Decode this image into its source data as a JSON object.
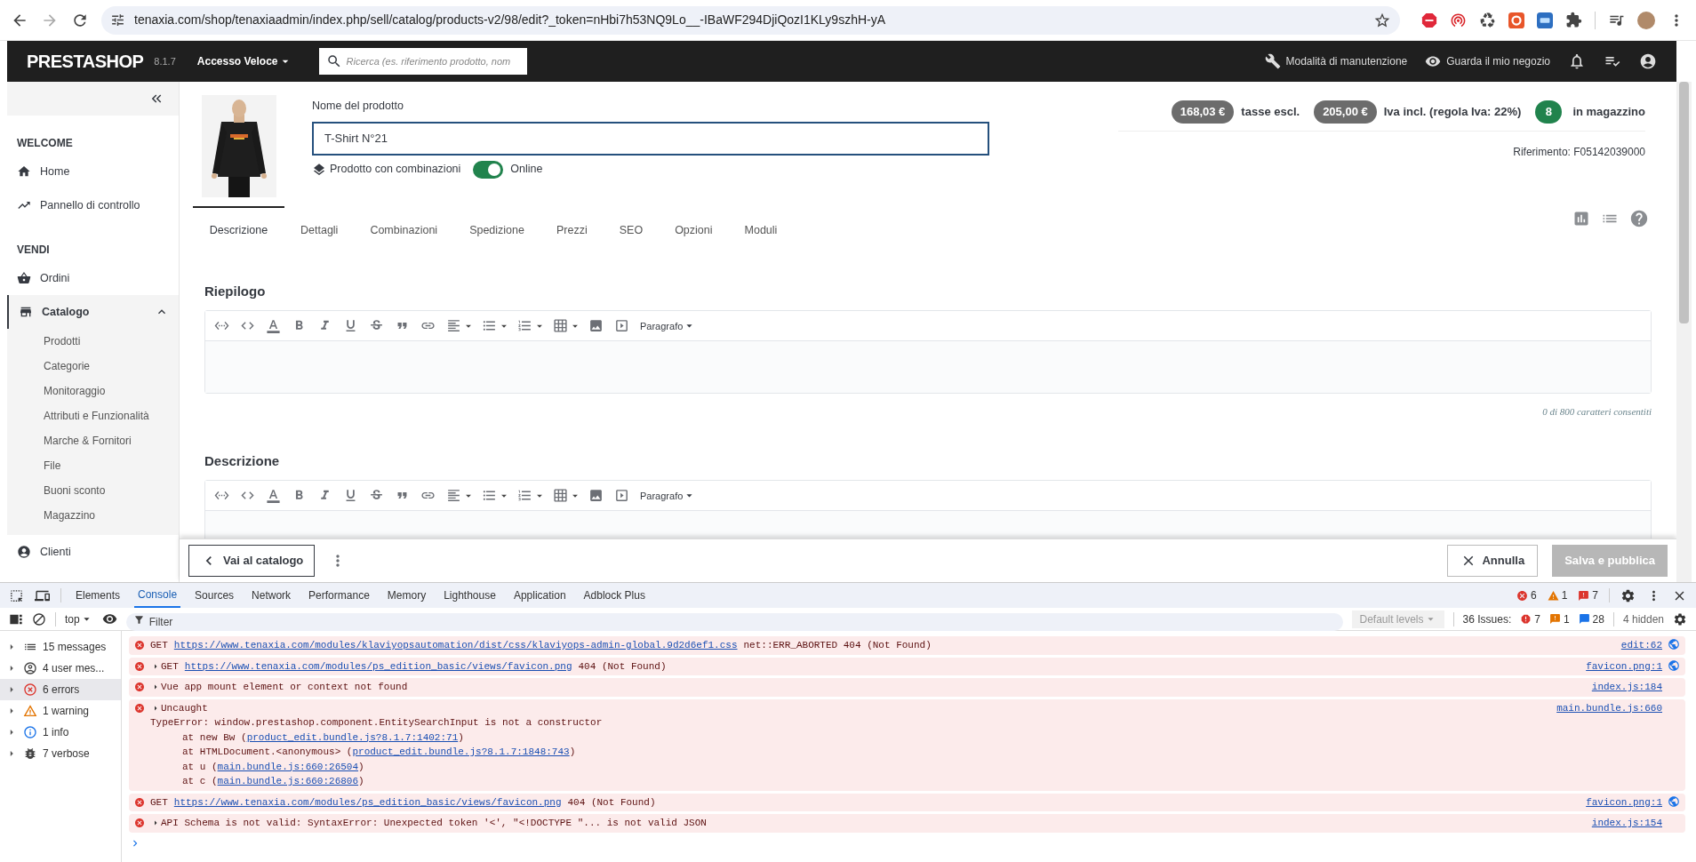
{
  "browser": {
    "url": "tenaxia.com/shop/tenaxiaadmin/index.php/sell/catalog/products-v2/98/edit?_token=nHbi7h53NQ9Lo__-IBaWF294DjiQozI1KLy9szhH-yA"
  },
  "header": {
    "logo": "PRESTASHOP",
    "version": "8.1.7",
    "quick_access": "Accesso Veloce",
    "search": {
      "placeholder": "Ricerca (es. riferimento prodotto, nom"
    },
    "links": [
      {
        "label": "Modalità di manutenzione"
      },
      {
        "label": "Guarda il mio negozio"
      }
    ]
  },
  "sidebar": {
    "sections": [
      {
        "title": "WELCOME",
        "items": [
          {
            "label": "Home",
            "selected": false
          },
          {
            "label": "Pannello di controllo",
            "selected": false
          }
        ]
      },
      {
        "title": "VENDI",
        "items": [
          {
            "label": "Ordini",
            "selected": false
          },
          {
            "label": "Catalogo",
            "selected": true,
            "expanded": true,
            "children": [
              {
                "label": "Prodotti"
              },
              {
                "label": "Categorie"
              },
              {
                "label": "Monitoraggio"
              },
              {
                "label": "Attributi e Funzionalità"
              },
              {
                "label": "Marche & Fornitori"
              },
              {
                "label": "File"
              },
              {
                "label": "Buoni sconto"
              },
              {
                "label": "Magazzino"
              }
            ]
          },
          {
            "label": "Clienti",
            "selected": false
          }
        ]
      }
    ]
  },
  "product": {
    "name_label": "Nome del prodotto",
    "name": "T-Shirt N°21",
    "combinations_label": "Prodotto con combinazioni",
    "online": {
      "on": true,
      "label": "Online"
    },
    "prices": [
      {
        "amount": "168,03 €",
        "label": "tasse escl."
      },
      {
        "amount": "205,00 €",
        "label": "Iva incl. (regola Iva: 22%)"
      }
    ],
    "stock": {
      "count": "8",
      "label": "in magazzino"
    },
    "reference": "Riferimento: F05142039000"
  },
  "tabs": [
    {
      "label": "Descrizione",
      "selected": true
    },
    {
      "label": "Dettagli",
      "selected": false
    },
    {
      "label": "Combinazioni",
      "selected": false
    },
    {
      "label": "Spedizione",
      "selected": false
    },
    {
      "label": "Prezzi",
      "selected": false
    },
    {
      "label": "SEO",
      "selected": false
    },
    {
      "label": "Opzioni",
      "selected": false
    },
    {
      "label": "Moduli",
      "selected": false
    }
  ],
  "editors": [
    {
      "title": "Riepilogo",
      "format": "Paragrafo",
      "counter": "0 di 800 caratteri consentiti"
    },
    {
      "title": "Descrizione",
      "format": "Paragrafo"
    }
  ],
  "actions": {
    "back": "Vai al catalogo",
    "cancel": "Annulla",
    "save": {
      "label": "Salva e pubblica",
      "disabled": true
    }
  },
  "devtools": {
    "tabs": [
      {
        "label": "Elements",
        "selected": false
      },
      {
        "label": "Console",
        "selected": true
      },
      {
        "label": "Sources",
        "selected": false
      },
      {
        "label": "Network",
        "selected": false
      },
      {
        "label": "Performance",
        "selected": false
      },
      {
        "label": "Memory",
        "selected": false
      },
      {
        "label": "Lighthouse",
        "selected": false
      },
      {
        "label": "Application",
        "selected": false
      },
      {
        "label": "Adblock Plus",
        "selected": false
      }
    ],
    "counts": [
      {
        "kind": "error",
        "count": "6"
      },
      {
        "kind": "warning",
        "count": "1"
      },
      {
        "kind": "issue",
        "count": "7"
      }
    ],
    "toolbar": {
      "context": "top",
      "filter": {
        "placeholder": "Filter"
      },
      "levels": "Default levels",
      "issues_label": "36 Issues:",
      "issues": [
        {
          "kind": "error",
          "count": "7"
        },
        {
          "kind": "warning",
          "count": "1"
        },
        {
          "kind": "info",
          "count": "28"
        }
      ],
      "hidden": "4 hidden"
    },
    "sidebar": [
      {
        "kind": "messages",
        "label": "15 messages",
        "selected": false
      },
      {
        "kind": "user",
        "label": "4 user mes...",
        "selected": false
      },
      {
        "kind": "errors",
        "label": "6 errors",
        "selected": true
      },
      {
        "kind": "warning",
        "label": "1 warning",
        "selected": false
      },
      {
        "kind": "info",
        "label": "1 info",
        "selected": false
      },
      {
        "kind": "verbose",
        "label": "7 verbose",
        "selected": false
      }
    ],
    "messages": [
      {
        "expandable": false,
        "prefix": "GET",
        "link": "https://www.tenaxia.com/modules/klaviyopsautomation/dist/css/klaviyops-admin-global.9d2d6ef1.css",
        "text": "net::ERR_ABORTED 404 (Not Found)",
        "source": "edit:62",
        "network": true
      },
      {
        "expandable": true,
        "prefix": "GET",
        "link": "https://www.tenaxia.com/modules/ps_edition_basic/views/favicon.png",
        "text": "404 (Not Found)",
        "source": "favicon.png:1",
        "network": true
      },
      {
        "expandable": true,
        "text": "Vue app mount element or context not found",
        "source": "index.js:184",
        "network": false
      },
      {
        "expandable": true,
        "text": "Uncaught",
        "source": "main.bundle.js:660",
        "network": false,
        "details": "TypeError: window.prestashop.component.EntitySearchInput is not a constructor",
        "stack": [
          {
            "text": "at new Bw (",
            "link": "product_edit.bundle.js?8.1.7:1402:71",
            "suffix": ")"
          },
          {
            "text": "at HTMLDocument.<anonymous> (",
            "link": "product_edit.bundle.js?8.1.7:1848:743",
            "suffix": ")"
          },
          {
            "text": "at u (",
            "link": "main.bundle.js:660:26504",
            "suffix": ")"
          },
          {
            "text": "at c (",
            "link": "main.bundle.js:660:26806",
            "suffix": ")"
          }
        ]
      },
      {
        "expandable": false,
        "prefix": "GET",
        "link": "https://www.tenaxia.com/modules/ps_edition_basic/views/favicon.png",
        "text": "404 (Not Found)",
        "source": "favicon.png:1",
        "network": true
      },
      {
        "expandable": true,
        "text": "API Schema is not valid: SyntaxError: Unexpected token '<', \"<!DOCTYPE \"... is not valid JSON",
        "source": "index.js:154",
        "network": false
      }
    ]
  }
}
